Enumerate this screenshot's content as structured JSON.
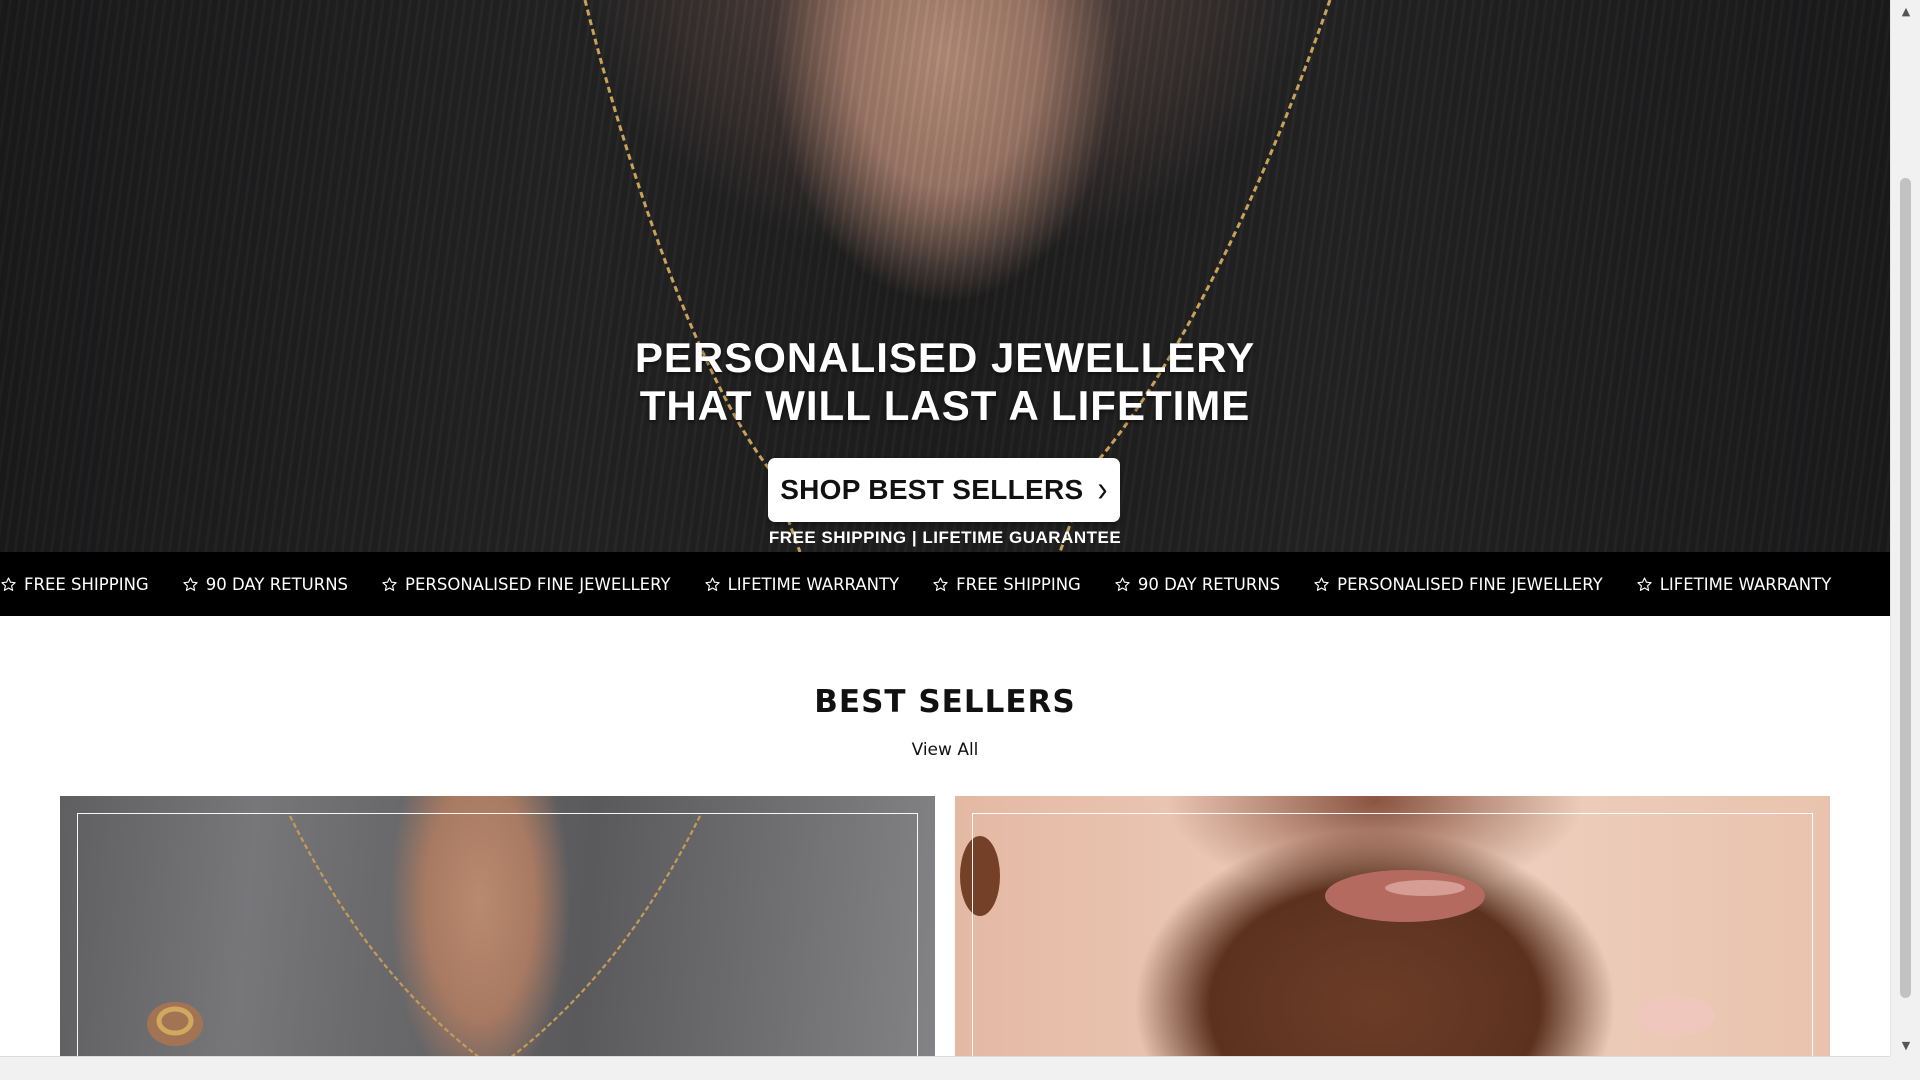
{
  "hero": {
    "headline_line1": "PERSONALISED JEWELLERY",
    "headline_line2": "THAT WILL LAST A LIFETIME",
    "cta_label": "SHOP BEST SELLERS",
    "cta_icon": "chevron-right-icon",
    "subline": "FREE SHIPPING | LIFETIME GUARANTEE"
  },
  "marquee": {
    "icon": "star-outline-icon",
    "items": [
      "FREE SHIPPING",
      "90 DAY RETURNS",
      "PERSONALISED FINE JEWELLERY",
      "LIFETIME WARRANTY",
      "FREE SHIPPING",
      "90 DAY RETURNS",
      "PERSONALISED FINE JEWELLERY",
      "LIFETIME WARRANTY"
    ]
  },
  "best_sellers": {
    "title": "BEST SELLERS",
    "view_all": "View All",
    "cards": [
      {
        "image": "model-wearing-gold-chain-necklace-grey-blazer"
      },
      {
        "image": "model-wearing-gold-necklace-warm-background"
      }
    ]
  },
  "colors": {
    "marquee_bg": "#000000",
    "marquee_text": "#ffffff",
    "cta_bg": "#ffffff",
    "page_bg": "#ffffff"
  }
}
